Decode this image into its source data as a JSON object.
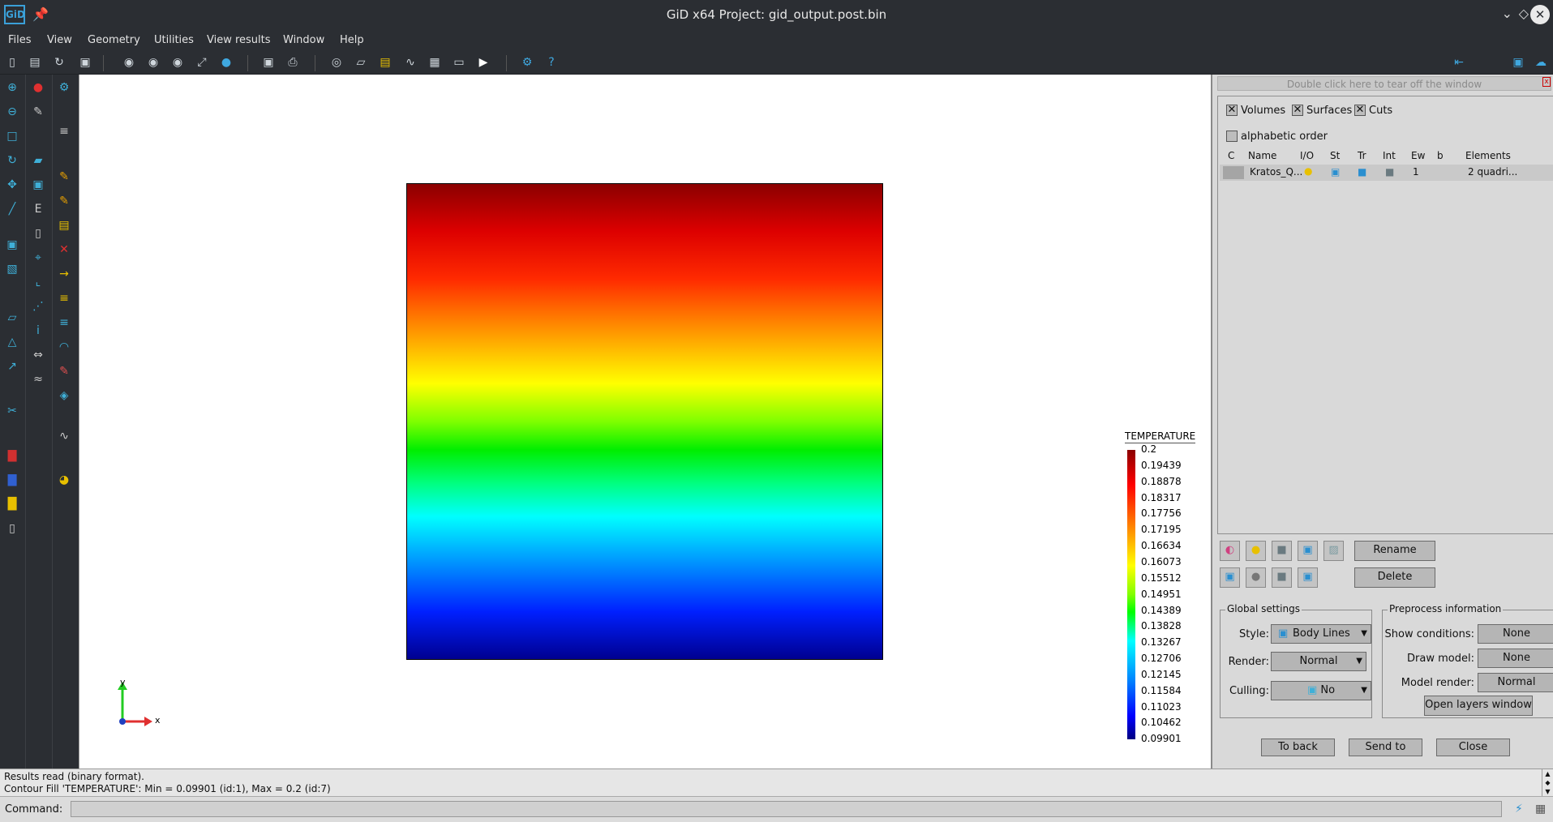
{
  "titlebar": {
    "app_icon": "GiD",
    "title": "GiD x64 Project: gid_output.post.bin",
    "icons": [
      "pin-icon",
      "minimize-icon",
      "maximize-icon",
      "close-icon"
    ]
  },
  "menu": [
    "Files",
    "View",
    "Geometry",
    "Utilities",
    "View results",
    "Window",
    "Help"
  ],
  "viewport": {
    "axes": {
      "x": "x",
      "y": "y"
    }
  },
  "legend": {
    "title": "TEMPERATURE",
    "values": [
      "0.2",
      "0.19439",
      "0.18878",
      "0.18317",
      "0.17756",
      "0.17195",
      "0.16634",
      "0.16073",
      "0.15512",
      "0.14951",
      "0.14389",
      "0.13828",
      "0.13267",
      "0.12706",
      "0.12145",
      "0.11584",
      "0.11023",
      "0.10462",
      "0.09901"
    ]
  },
  "layers": {
    "tearoff_text": "Double click here to tear off the window",
    "checkboxes": [
      {
        "label": "Volumes",
        "checked": true
      },
      {
        "label": "Surfaces",
        "checked": true
      },
      {
        "label": "Cuts",
        "checked": true
      }
    ],
    "alphabetic_order": {
      "label": "alphabetic order",
      "checked": false
    },
    "columns": [
      "C",
      "Name",
      "I/O",
      "St",
      "Tr",
      "Int",
      "Ew",
      "b",
      "Elements"
    ],
    "rows": [
      {
        "name": "Kratos_Q...",
        "ew": "1",
        "elements": "2 quadri..."
      }
    ],
    "rename_label": "Rename",
    "delete_label": "Delete"
  },
  "global_settings": {
    "title": "Global settings",
    "style_label": "Style:",
    "style_value": "Body Lines",
    "render_label": "Render:",
    "render_value": "Normal",
    "culling_label": "Culling:",
    "culling_value": "No"
  },
  "preprocess_info": {
    "title": "Preprocess information",
    "show_conditions_label": "Show conditions:",
    "show_conditions_value": "None",
    "draw_model_label": "Draw model:",
    "draw_model_value": "None",
    "model_render_label": "Model render:",
    "model_render_value": "Normal",
    "open_layers_label": "Open layers window"
  },
  "bottom_buttons": {
    "to_back": "To back",
    "send_to": "Send to",
    "close": "Close"
  },
  "status": {
    "line1": "Results read (binary format).",
    "line2": "Contour Fill 'TEMPERATURE': Min = 0.09901 (id:1), Max = 0.2 (id:7)"
  },
  "command": {
    "label": "Command:",
    "value": ""
  }
}
